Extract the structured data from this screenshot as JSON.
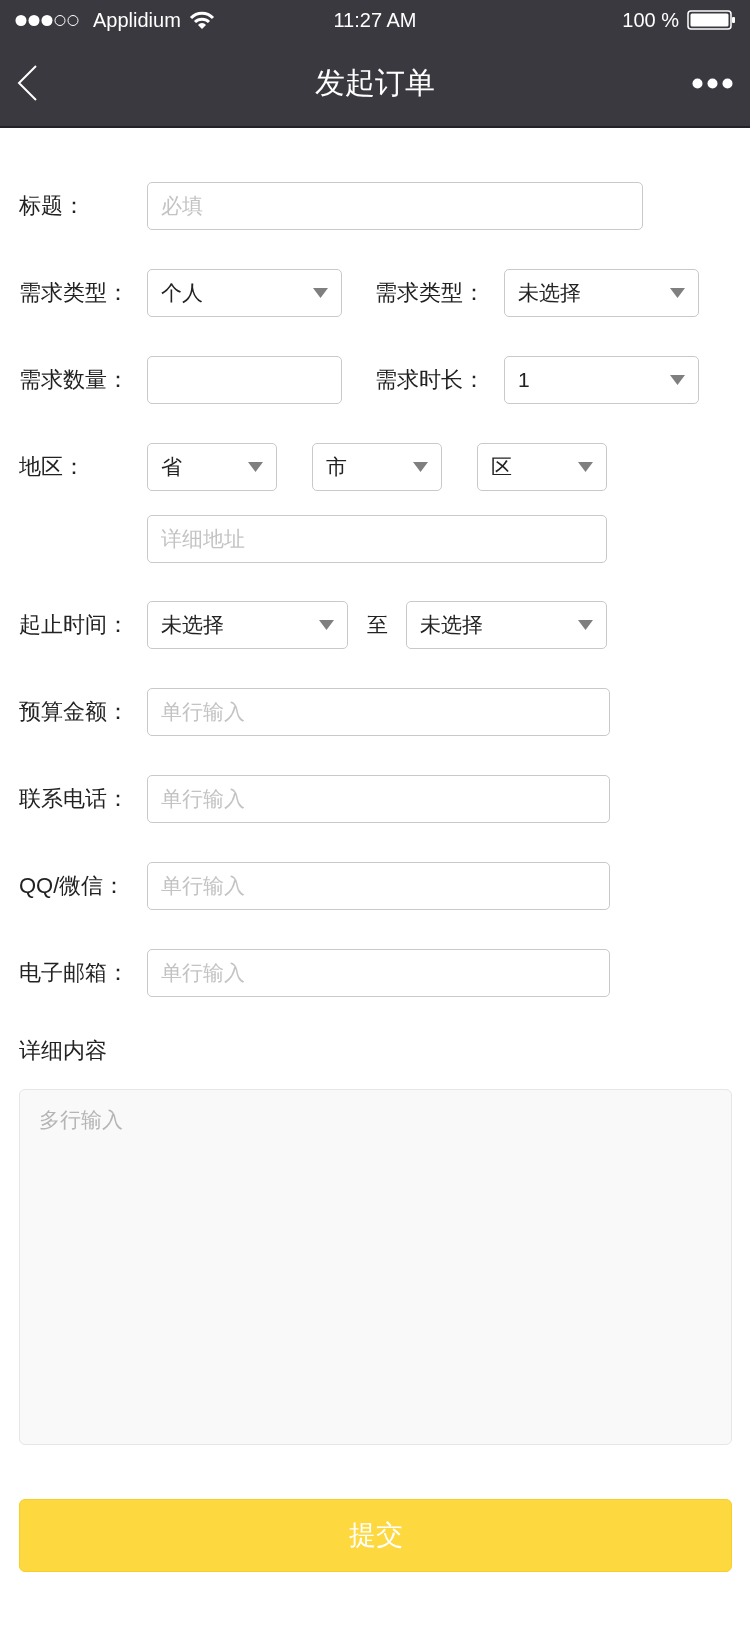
{
  "status_bar": {
    "carrier": "Applidium",
    "time": "11:27 AM",
    "battery": "100 %"
  },
  "nav": {
    "title": "发起订单"
  },
  "form": {
    "rows": [
      {
        "kind": "input",
        "label": "标题：",
        "placeholder": "必填"
      },
      {
        "kind": "pair",
        "items": [
          {
            "kind": "select",
            "label": "需求类型：",
            "value": "个人"
          },
          {
            "kind": "select",
            "label": "需求类型：",
            "value": "未选择"
          }
        ]
      },
      {
        "kind": "pair",
        "items": [
          {
            "kind": "input",
            "label": "需求数量："
          },
          {
            "kind": "select",
            "label": "需求时长：",
            "value": "1"
          }
        ]
      },
      {
        "kind": "region",
        "label": "地区：",
        "selects": [
          {
            "value": "省"
          },
          {
            "value": "市"
          },
          {
            "value": "区"
          }
        ],
        "placeholder": "详细地址"
      },
      {
        "kind": "range",
        "label": "起止时间：",
        "from": "未选择",
        "separator": "至",
        "to": "未选择"
      },
      {
        "kind": "input",
        "label": "预算金额：",
        "placeholder": "单行输入"
      },
      {
        "kind": "input",
        "label": "联系电话：",
        "placeholder": "单行输入"
      },
      {
        "kind": "input",
        "label": "QQ/微信：",
        "placeholder": "单行输入"
      },
      {
        "kind": "input",
        "label": "电子邮箱：",
        "placeholder": "单行输入"
      }
    ]
  },
  "details": {
    "label": "详细内容",
    "placeholder": "多行输入"
  },
  "submit": {
    "label": "提交"
  }
}
